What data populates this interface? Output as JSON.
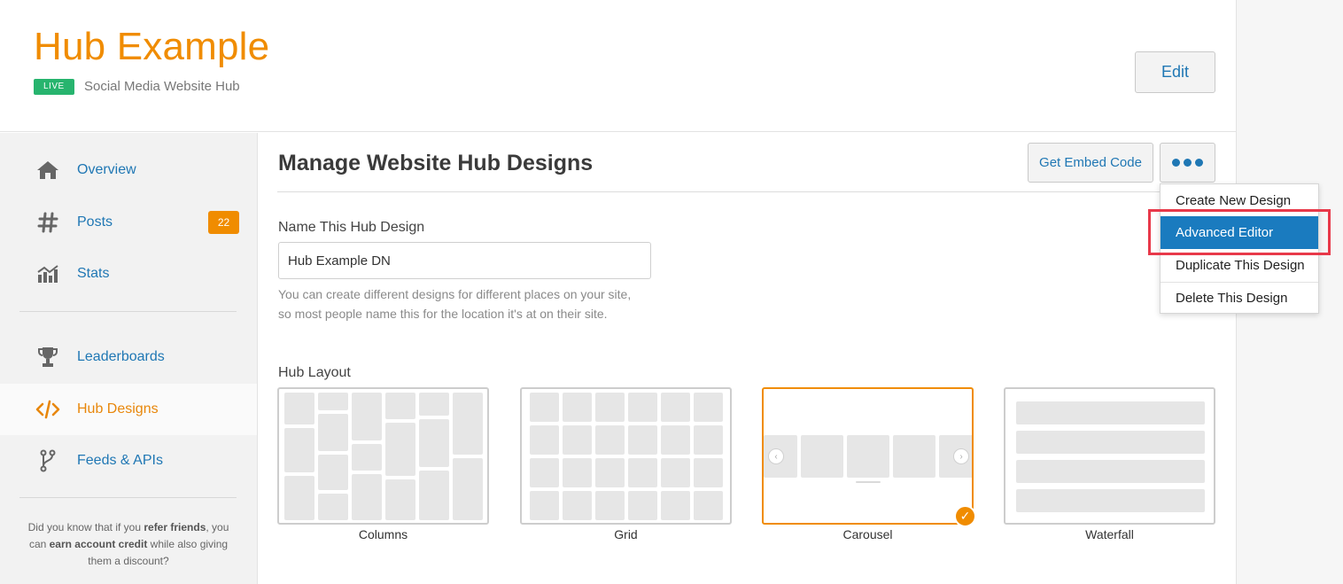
{
  "header": {
    "title": "Hub Example",
    "status_badge": "LIVE",
    "subtitle": "Social Media Website Hub",
    "edit_label": "Edit"
  },
  "sidebar": {
    "items": [
      {
        "label": "Overview",
        "icon": "home-icon"
      },
      {
        "label": "Posts",
        "icon": "hash-icon",
        "badge": "22"
      },
      {
        "label": "Stats",
        "icon": "chart-icon"
      },
      {
        "label": "Leaderboards",
        "icon": "trophy-icon"
      },
      {
        "label": "Hub Designs",
        "icon": "code-icon",
        "active": true
      },
      {
        "label": "Feeds & APIs",
        "icon": "branch-icon"
      }
    ],
    "tip": {
      "part1": "Did you know that if you ",
      "bold1": "refer friends",
      "part2": ", you can ",
      "bold2": "earn account credit",
      "part3": " while also giving them a discount?"
    }
  },
  "main": {
    "title": "Manage Website Hub Designs",
    "embed_label": "Get Embed Code",
    "more_icon": "ellipsis-icon",
    "name_label": "Name This Hub Design",
    "name_value": "Hub Example DN",
    "help_line1": "You can create different designs for different places on your site,",
    "help_line2": "so most people name this for the location it's at on their site.",
    "layout_label": "Hub Layout",
    "layouts": [
      {
        "label": "Columns"
      },
      {
        "label": "Grid"
      },
      {
        "label": "Carousel",
        "selected": true
      },
      {
        "label": "Waterfall"
      }
    ]
  },
  "dropdown": {
    "items": [
      {
        "label": "Create New Design"
      },
      {
        "label": "Advanced Editor",
        "highlighted": true
      },
      {
        "label": "Duplicate This Design"
      },
      {
        "label": "Delete This Design"
      }
    ]
  },
  "colors": {
    "brand_orange": "#f08c00",
    "link_blue": "#1f77b4",
    "live_green": "#27b46e",
    "menu_highlight": "#1a7bbf",
    "annotation_red": "#e8394a"
  }
}
